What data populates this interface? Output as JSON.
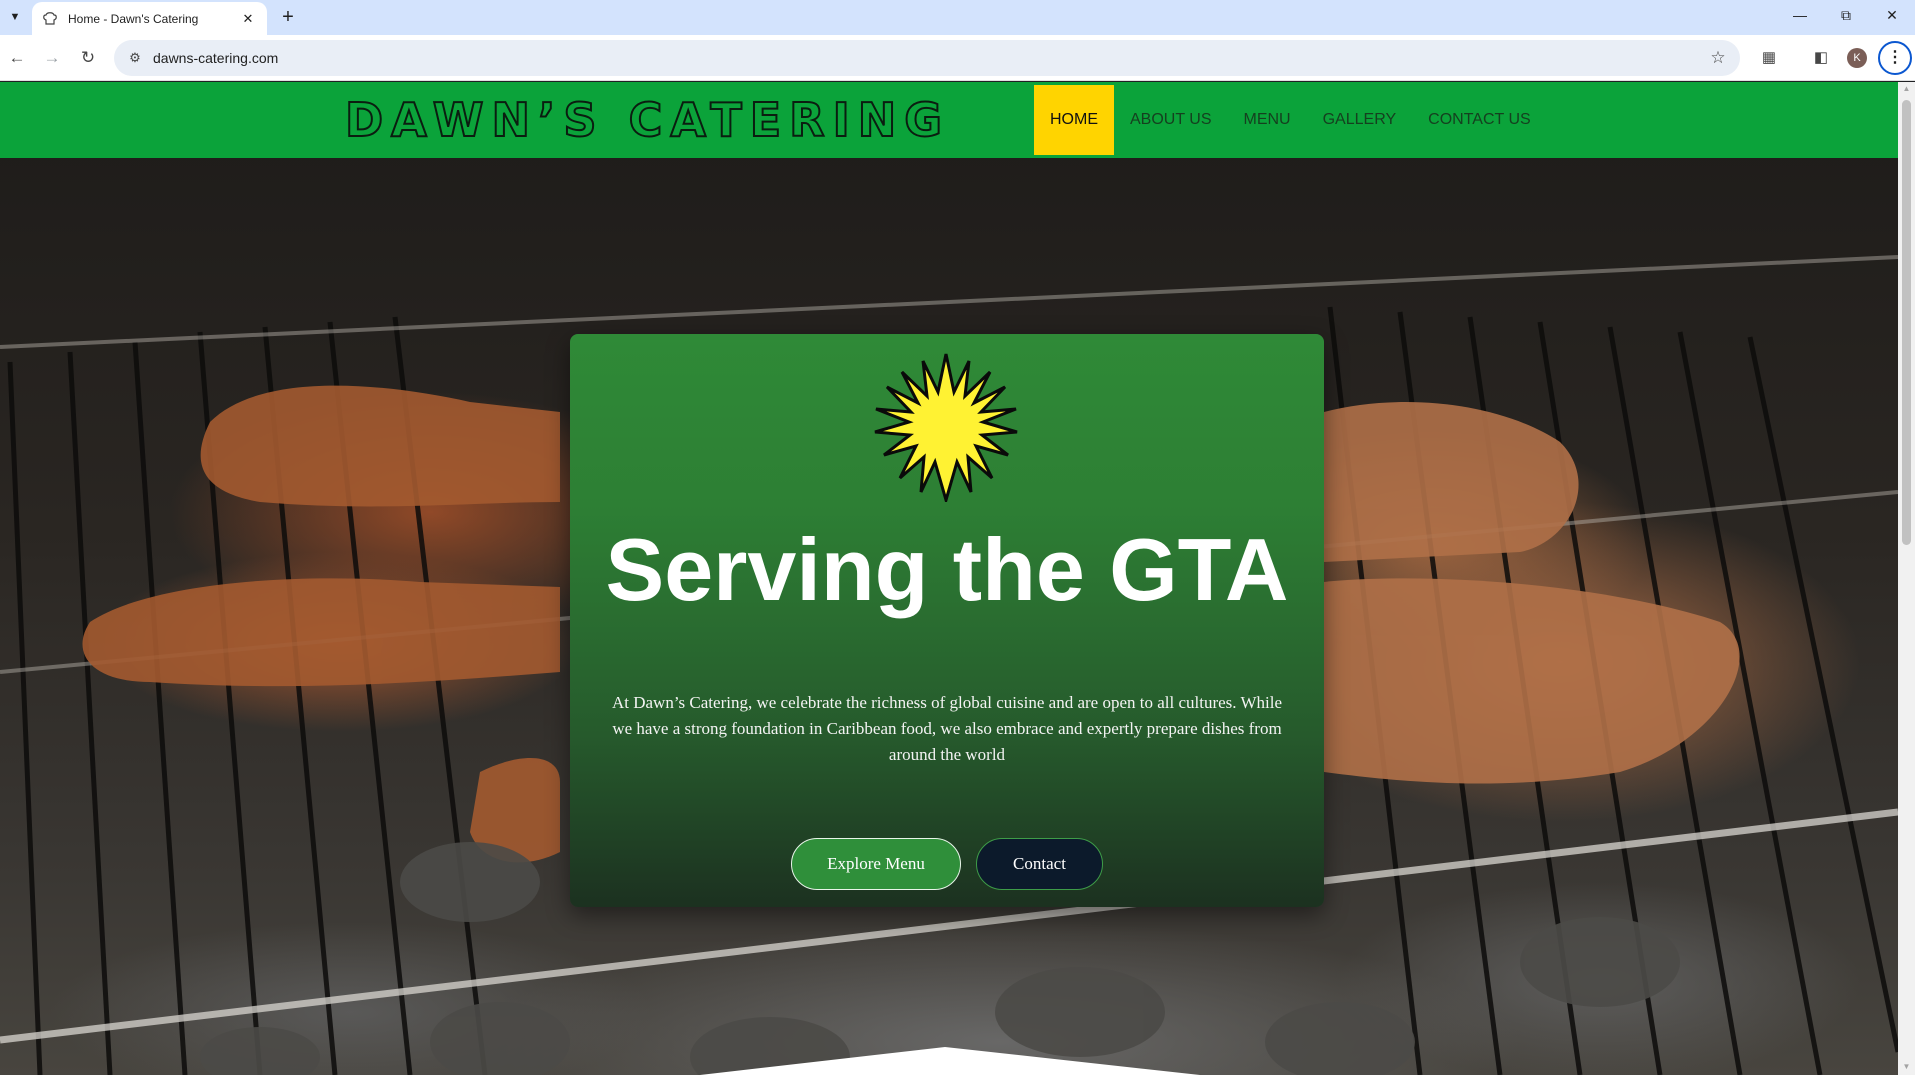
{
  "browser": {
    "tab_title": "Home - Dawn's Catering",
    "url": "dawns-catering.com",
    "profile_initial": "K",
    "icons": {
      "tab_search": "chevron-down-icon",
      "favicon": "chef-hat-icon",
      "tab_close": "close-icon",
      "new_tab": "plus-icon",
      "back": "back-arrow-icon",
      "forward": "forward-arrow-icon",
      "reload": "reload-icon",
      "site_info": "site-info-icon",
      "bookmark": "star-icon",
      "extensions": "puzzle-icon",
      "side_panel": "side-panel-icon",
      "menu": "kebab-menu-icon"
    }
  },
  "site": {
    "logo": "DAWN’S CATERING",
    "nav": [
      {
        "label": "HOME",
        "active": true
      },
      {
        "label": "ABOUT US",
        "active": false
      },
      {
        "label": "MENU",
        "active": false
      },
      {
        "label": "GALLERY",
        "active": false
      },
      {
        "label": "CONTACT US",
        "active": false
      }
    ]
  },
  "hero": {
    "title": "Serving the GTA",
    "description": "At Dawn’s Catering, we celebrate the richness of global cuisine and are open to all cultures. While we have a strong foundation in Caribbean food, we also embrace and expertly prepare dishes from around the world",
    "primary_button": "Explore Menu",
    "secondary_button": "Contact",
    "emblem_icon": "sun-icon"
  },
  "colors": {
    "header_green": "#0ba33a",
    "nav_active": "#ffd400",
    "sun_yellow": "#fff233",
    "card_green": "#2f8a37",
    "contact_button": "#0c1a2b"
  }
}
